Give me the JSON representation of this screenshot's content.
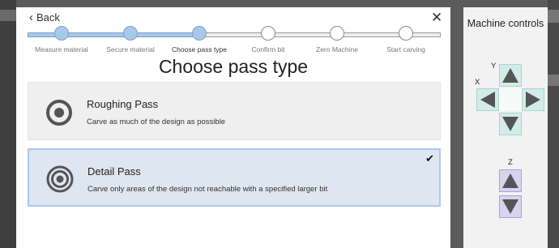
{
  "dialog": {
    "back_label": "Back",
    "title": "Choose pass type"
  },
  "steps": [
    {
      "label": "Measure material",
      "state": "done"
    },
    {
      "label": "Secure material",
      "state": "done"
    },
    {
      "label": "Choose pass type",
      "state": "current"
    },
    {
      "label": "Confirm bit",
      "state": "todo"
    },
    {
      "label": "Zero Machine",
      "state": "todo"
    },
    {
      "label": "Start carving",
      "state": "todo"
    }
  ],
  "options": [
    {
      "name": "Roughing Pass",
      "description": "Carve as much of the design as possible",
      "selected": false
    },
    {
      "name": "Detail Pass",
      "description": "Carve only areas of the design not reachable with a specified larger bit",
      "selected": true
    }
  ],
  "machine_controls": {
    "title": "Machine controls",
    "axis_x": "X",
    "axis_y": "Y",
    "axis_z": "Z"
  },
  "colors": {
    "progress_done": "#a7c8ea",
    "selected_option_bg": "#dde6f1",
    "selected_option_border": "#a9c9ee",
    "xy_jog_bg": "#d2ece8",
    "z_jog_bg": "#d6d4ef",
    "arrow": "#555555"
  }
}
